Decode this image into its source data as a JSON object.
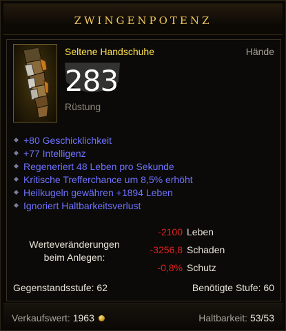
{
  "header": {
    "title": "ZWINGENPOTENZ"
  },
  "item": {
    "name": "Seltene Handschuhe",
    "slot": "Hände",
    "armor_value": "283",
    "armor_label": "Rüstung",
    "icon": "gauntlet-icon"
  },
  "affixes": [
    "+80 Geschicklichkeit",
    "+77 Intelligenz",
    "Regeneriert 48 Leben pro Sekunde",
    "Kritische Trefferchance um 8,5% erhöht",
    "Heilkugeln gewähren +1894 Leben",
    "Ignoriert Haltbarkeitsverlust"
  ],
  "stat_changes": {
    "label_line1": "Werteveränderungen",
    "label_line2": "beim Anlegen:",
    "rows": [
      {
        "value": "-2100",
        "name": "Leben"
      },
      {
        "value": "-3256,8",
        "name": "Schaden"
      },
      {
        "value": "-0,8%",
        "name": "Schutz"
      }
    ]
  },
  "levels": {
    "item_level_label": "Gegenstandsstufe:",
    "item_level": "62",
    "required_label": "Benötigte Stufe:",
    "required": "60"
  },
  "footer": {
    "sell_label": "Verkaufswert:",
    "sell_value": "1963",
    "durability_label": "Haltbarkeit:",
    "durability_value": "53/53"
  },
  "colors": {
    "title": "#f2c95c",
    "item_name_rare": "#ffe14d",
    "affix": "#6f72ff",
    "negative": "#e02121"
  }
}
